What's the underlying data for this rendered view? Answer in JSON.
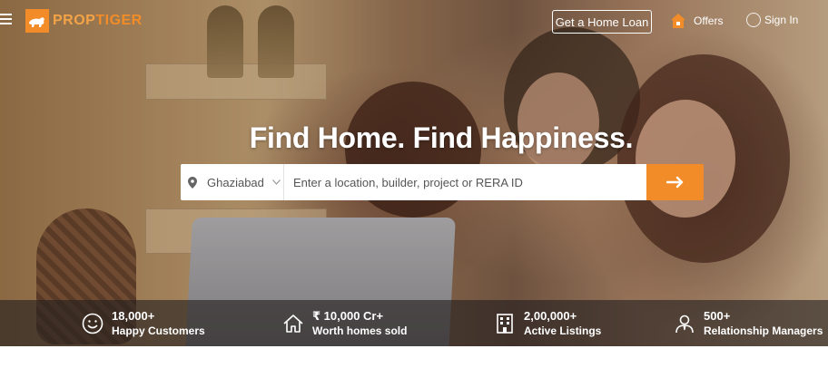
{
  "brand": {
    "name_part1": "PROP",
    "name_part2": "TIGER",
    "accent": "#f28c28"
  },
  "header": {
    "home_loan_label": "Get a Home Loan",
    "offers_label": "Offers",
    "sign_in_label": "Sign In",
    "icons": {
      "menu": "hamburger-icon",
      "offers": "house-tag-icon",
      "sign_in": "user-circle-icon"
    }
  },
  "hero": {
    "headline": "Find Home. Find Happiness."
  },
  "search": {
    "city": "Ghaziabad",
    "placeholder": "Enter a location, builder, project or RERA ID",
    "value": "",
    "icons": {
      "city": "location-pin-icon",
      "city_dropdown": "chevron-down-icon",
      "submit": "arrow-right-icon"
    }
  },
  "stats": [
    {
      "value": "18,000+",
      "label": "Happy Customers",
      "icon": "smiley-icon"
    },
    {
      "value": "₹ 10,000 Cr+",
      "label": "Worth homes sold",
      "icon": "house-outline-icon"
    },
    {
      "value": "2,00,000+",
      "label": "Active Listings",
      "icon": "building-icon"
    },
    {
      "value": "500+",
      "label": "Relationship Managers",
      "icon": "manager-icon"
    }
  ]
}
